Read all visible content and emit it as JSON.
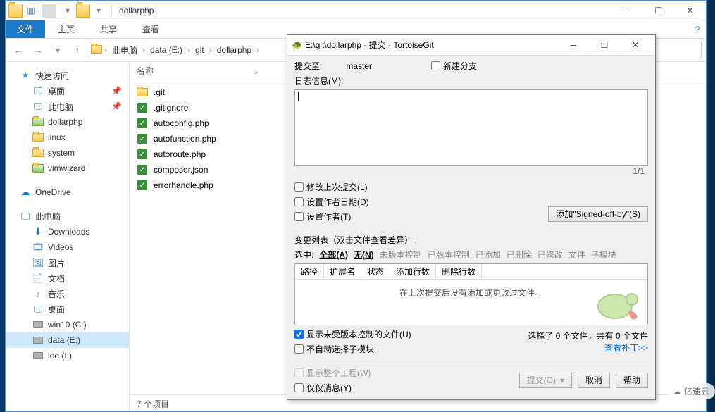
{
  "explorer": {
    "window_title": "dollarphp",
    "tabs": {
      "file": "文件",
      "home": "主页",
      "share": "共享",
      "view": "查看"
    },
    "nav": {
      "breadcrumb": [
        "此电脑",
        "data (E:)",
        "git",
        "dollarphp"
      ],
      "search_placeholder": "🔍"
    },
    "columns": {
      "name": "名称"
    },
    "tree": {
      "quick_access": "快速访问",
      "desktop": "桌面",
      "this_pc": "此电脑",
      "dollarphp": "dollarphp",
      "linux": "linux",
      "system": "system",
      "vimwizard": "vimwizard",
      "onedrive": "OneDrive",
      "this_pc2": "此电脑",
      "downloads": "Downloads",
      "videos": "Videos",
      "pictures": "图片",
      "documents": "文档",
      "music": "音乐",
      "desktop2": "桌面",
      "win10": "win10 (C:)",
      "data": "data (E:)",
      "lee": "lee (I:)"
    },
    "files": [
      ".git",
      ".gitignore",
      "autoconfig.php",
      "autofunction.php",
      "autoroute.php",
      "composer.json",
      "errorhandle.php"
    ],
    "status": "7 个项目"
  },
  "dialog": {
    "title": "E:\\git\\dollarphp - 提交 - TortoiseGit",
    "commit_to_label": "提交至:",
    "branch": "master",
    "new_branch": "新建分支",
    "log_label": "日志信息(M):",
    "counter": "1/1",
    "opts": {
      "amend": "修改上次提交(L)",
      "set_date": "设置作者日期(D)",
      "set_author": "设置作者(T)",
      "add_signed": "添加\"Signed-off-by\"(S)"
    },
    "changes_label": "变更列表（双击文件查看差异）:",
    "filter_label": "选中:",
    "filters": [
      "全部(A)",
      "无(N)",
      "未版本控制",
      "已版本控制",
      "已添加",
      "已删除",
      "已修改",
      "文件",
      "子模块"
    ],
    "list_cols": [
      "路径",
      "扩展名",
      "状态",
      "添加行数",
      "删除行数"
    ],
    "list_empty": "在上次提交后没有添加或更改过文件。",
    "selection_info": "选择了 0 个文件，共有 0 个文件",
    "show_unversioned": "显示未受版本控制的文件(U)",
    "no_auto_submodule": "不自动选择子模块",
    "view_patch": "查看补丁>>",
    "show_whole": "显示整个工程(W)",
    "only_msg": "仅仅消息(Y)",
    "commit_btn": "提交(O)",
    "cancel": "取消",
    "help": "帮助"
  },
  "badge": "亿速云"
}
